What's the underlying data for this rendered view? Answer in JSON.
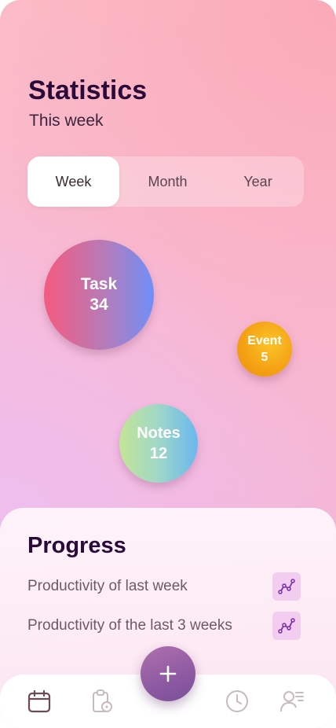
{
  "header": {
    "title": "Statistics",
    "subtitle": "This week"
  },
  "period_tabs": {
    "items": [
      "Week",
      "Month",
      "Year"
    ],
    "selected": "Week"
  },
  "bubbles": {
    "task": {
      "label": "Task",
      "count": "34"
    },
    "event": {
      "label": "Event",
      "count": "5"
    },
    "notes": {
      "label": "Notes",
      "count": "12"
    }
  },
  "progress": {
    "title": "Progress",
    "items": [
      {
        "label": "Productivity of last week",
        "icon": "chart-line-icon"
      },
      {
        "label": "Productivity of the last 3 weeks",
        "icon": "chart-line-icon"
      }
    ]
  },
  "bottom_nav": {
    "items": [
      "calendar-icon",
      "clipboard-clock-icon",
      "clock-icon",
      "profile-list-icon"
    ],
    "selected": "calendar-icon",
    "fab_icon": "plus-icon"
  },
  "colors": {
    "title": "#2a0a3a",
    "accent_fab": "#8d5aa2",
    "task_gradient": [
      "#f55a7e",
      "#6f8ff8"
    ],
    "event_gradient": [
      "#fbc42a",
      "#ec8e10"
    ],
    "notes_gradient": [
      "#c4e596",
      "#6ab7f0"
    ],
    "chart_button_bg": "#f2cdf0"
  }
}
